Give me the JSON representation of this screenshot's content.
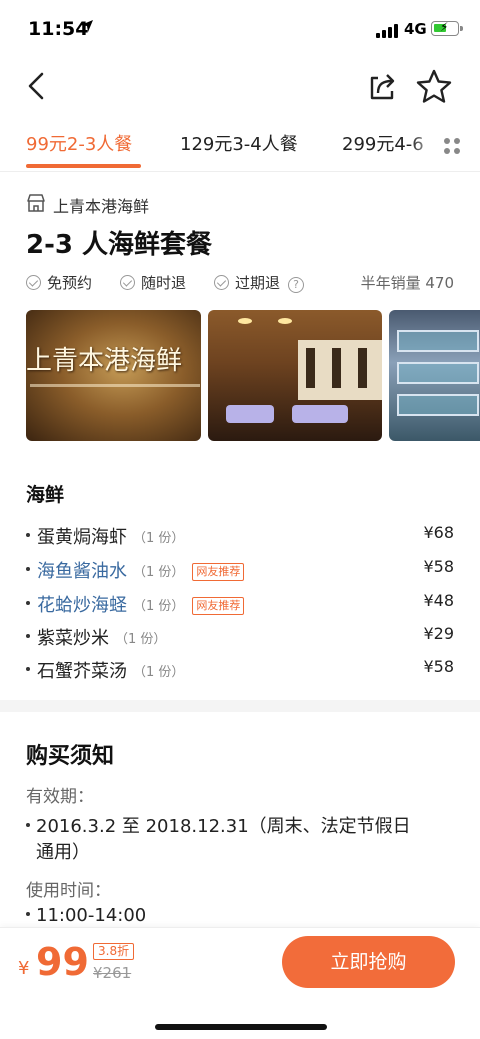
{
  "status": {
    "time": "11:54",
    "network": "4G"
  },
  "tabs": [
    {
      "label": "99元2-3人餐",
      "active": true
    },
    {
      "label": "129元3-4人餐",
      "active": false
    },
    {
      "label": "299元4-6",
      "active": false
    }
  ],
  "store": {
    "name": "上青本港海鲜"
  },
  "deal": {
    "title": "2-3 人海鲜套餐"
  },
  "tags": [
    "免预约",
    "随时退",
    "过期退"
  ],
  "help_icon": "?",
  "sales": "半年销量 470",
  "gallery": {
    "sign_text": "上青本港海鲜"
  },
  "menu": {
    "section_title": "海鲜",
    "items": [
      {
        "name": "蛋黄焗海虾",
        "qty": "（1 份）",
        "badge": "",
        "price": "¥68"
      },
      {
        "name": "海鱼酱油水",
        "qty": "（1 份）",
        "badge": "网友推荐",
        "price": "¥58"
      },
      {
        "name": "花蛤炒海蛏",
        "qty": "（1 份）",
        "badge": "网友推荐",
        "price": "¥48"
      },
      {
        "name": "紫菜炒米",
        "qty": "（1 份）",
        "badge": "",
        "price": "¥29"
      },
      {
        "name": "石蟹芥菜汤",
        "qty": "（1 份）",
        "badge": "",
        "price": "¥58"
      }
    ]
  },
  "notice": {
    "title": "购买须知",
    "validity_label": "有效期：",
    "validity_line1": "2016.3.2 至 2018.12.31（周末、法定节假日",
    "validity_line2": "通用）",
    "time_label": "使用时间：",
    "time_value": "11:00-14:00"
  },
  "purchase": {
    "currency": "¥",
    "price": "99",
    "discount": "3.8折",
    "original_price": "¥261",
    "buy_label": "立即抢购"
  },
  "colors": {
    "accent": "#f06a35",
    "link": "#3a6aa0"
  }
}
